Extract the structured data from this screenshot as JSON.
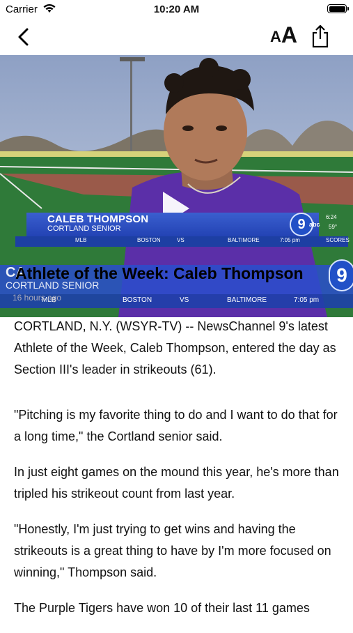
{
  "status_bar": {
    "carrier": "Carrier",
    "time": "10:20 AM"
  },
  "nav": {
    "text_size_small": "A",
    "text_size_large": "A",
    "icons": [
      "back-chevron-icon",
      "text-size-icon",
      "share-icon"
    ]
  },
  "video": {
    "lower_third": {
      "name": "CALEB THOMPSON",
      "subtitle": "CORTLAND SENIOR",
      "ticker": {
        "league": "MLB",
        "team1": "BOSTON",
        "vs": "VS",
        "team2": "BALTIMORE",
        "game_time": "7:05 pm",
        "scores": "SCORES"
      },
      "channel_time": "6:24",
      "temperature": "59°",
      "station": "9",
      "network": "abc"
    },
    "overlay_name_fragment": "CA",
    "overlay_ticker_time": "7:05 pm"
  },
  "article": {
    "headline": "Athlete of the Week: Caleb Thompson",
    "timestamp": "16 hours ago",
    "paragraphs": [
      "CORTLAND, N.Y. (WSYR-TV) -- NewsChannel 9's latest Athlete of the Week, Caleb Thompson, entered the day as Section III's leader in strikeouts (61).",
      "\"Pitching is my favorite thing to do and I want to do that for a long time,\" the Cortland senior said.",
      "In just eight games on the mound this year, he's more than tripled his strikeout count from last year.",
      "\"Honestly, I'm just trying to get wins and having the strikeouts is a great thing to have by I'm more focused on winning,\" Thompson said.",
      "The Purple Tigers have won 10 of their last 11 games"
    ]
  },
  "colors": {
    "graphic_blue": "#2343b4",
    "ticker_blue": "#1d3fa3",
    "jersey_purple": "#5b2fa8"
  }
}
